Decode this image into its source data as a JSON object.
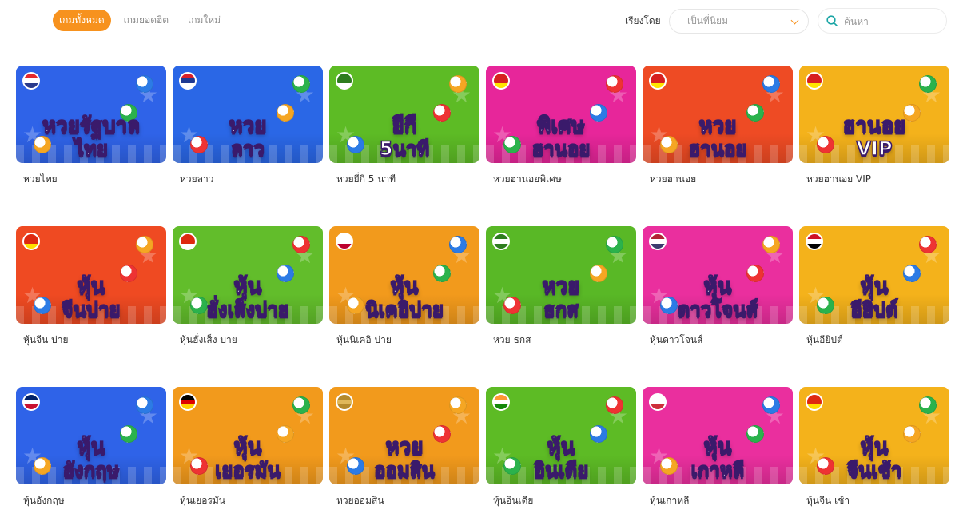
{
  "tabs": [
    {
      "label": "เกมทั้งหมด",
      "active": true
    },
    {
      "label": "เกมยอดฮิต",
      "active": false
    },
    {
      "label": "เกมใหม่",
      "active": false
    }
  ],
  "sort": {
    "label": "เรียงโดย",
    "selected": "เป็นที่นิยม"
  },
  "search": {
    "placeholder": "ค้นหา"
  },
  "games": [
    {
      "label": "หวยไทย",
      "art": [
        "หวยรัฐบาล",
        "ไทย"
      ],
      "bg": "#2f63e8",
      "flag": "thailand-flag-icon",
      "flagColors": [
        "#e4282d",
        "#ffffff",
        "#2a3a8c"
      ]
    },
    {
      "label": "หวยลาว",
      "art": [
        "หวย",
        "ลาว"
      ],
      "bg": "#2a67e6",
      "flag": "laos-flag-icon",
      "flagColors": [
        "#d9202a",
        "#1f3a93",
        "#ffffff"
      ]
    },
    {
      "label": "หวยยี่กี 5 นาที",
      "art": [
        "ยีกี",
        "5นาที"
      ],
      "bg": "#5dbb25",
      "flag": "yk-badge-icon",
      "flagColors": [
        "#2e7d1e",
        "#2e7d1e",
        "#ffffff"
      ]
    },
    {
      "label": "หวยฮานอยพิเศษ",
      "art": [
        "พิเศษ",
        "ฮานอย"
      ],
      "bg": "#e7269a",
      "flag": "vietnam-flag-icon",
      "flagColors": [
        "#d7201f",
        "#d7201f",
        "#ffe500"
      ]
    },
    {
      "label": "หวยฮานอย",
      "art": [
        "หวย",
        "ฮานอย"
      ],
      "bg": "#ee4b24",
      "flag": "vietnam-flag-icon",
      "flagColors": [
        "#d7201f",
        "#d7201f",
        "#ffe500"
      ]
    },
    {
      "label": "หวยฮานอย VIP",
      "art": [
        "ฮานอย",
        "VIP"
      ],
      "bg": "#f4b21b",
      "flag": "vietnam-flag-icon",
      "flagColors": [
        "#d7201f",
        "#d7201f",
        "#ffe500"
      ]
    },
    {
      "label": "หุ้นจีน บ่าย",
      "art": [
        "หุ้น",
        "จีนบ่าย"
      ],
      "bg": "#ef4a22",
      "flag": "china-flag-icon",
      "flagColors": [
        "#de2910",
        "#de2910",
        "#ffde00"
      ]
    },
    {
      "label": "หุ้นฮั่งเส็ง บ่าย",
      "art": [
        "หุ้น",
        "ฮั่งเส็งบ่าย"
      ],
      "bg": "#62bd2b",
      "flag": "hongkong-flag-icon",
      "flagColors": [
        "#de2910",
        "#de2910",
        "#ffffff"
      ]
    },
    {
      "label": "หุ้นนิเคอิ บ่าย",
      "art": [
        "หุ้น",
        "นิเคอิบ่าย"
      ],
      "bg": "#f29a1c",
      "flag": "japan-flag-icon",
      "flagColors": [
        "#ffffff",
        "#ffffff",
        "#bc002d"
      ]
    },
    {
      "label": "หวย ธกส",
      "art": [
        "หวย",
        "ธกส"
      ],
      "bg": "#59b826",
      "flag": "baac-badge-icon",
      "flagColors": [
        "#2e7d1e",
        "#ffffff",
        "#2e7d1e"
      ]
    },
    {
      "label": "หุ้นดาวโจนส์",
      "art": [
        "หุ้น",
        "ดาวโจนส์"
      ],
      "bg": "#ea2f9e",
      "flag": "usa-flag-icon",
      "flagColors": [
        "#b22234",
        "#ffffff",
        "#3c3b6e"
      ]
    },
    {
      "label": "หุ้นอียิปต์",
      "art": [
        "หุ้น",
        "อียิปต์"
      ],
      "bg": "#f4b21b",
      "flag": "egypt-flag-icon",
      "flagColors": [
        "#ce1126",
        "#ffffff",
        "#000000"
      ]
    },
    {
      "label": "หุ้นอังกฤษ",
      "art": [
        "หุ้น",
        "อังกฤษ"
      ],
      "bg": "#2f63e8",
      "flag": "uk-flag-icon",
      "flagColors": [
        "#012169",
        "#ffffff",
        "#c8102e"
      ]
    },
    {
      "label": "หุ้นเยอรมัน",
      "art": [
        "หุ้น",
        "เยอรมัน"
      ],
      "bg": "#f29a1c",
      "flag": "germany-flag-icon",
      "flagColors": [
        "#000000",
        "#dd0000",
        "#ffce00"
      ]
    },
    {
      "label": "หวยออมสิน",
      "art": [
        "หวย",
        "ออมสิน"
      ],
      "bg": "#f29a1c",
      "flag": "gsb-badge-icon",
      "flagColors": [
        "#b58a2c",
        "#e0b85a",
        "#b58a2c"
      ]
    },
    {
      "label": "หุ้นอินเดีย",
      "art": [
        "หุ้น",
        "อินเดีย"
      ],
      "bg": "#5dbb25",
      "flag": "india-flag-icon",
      "flagColors": [
        "#ff9933",
        "#ffffff",
        "#138808"
      ]
    },
    {
      "label": "หุ้นเกาหลี",
      "art": [
        "หุ้น",
        "เกาหลี"
      ],
      "bg": "#ea2f9e",
      "flag": "korea-flag-icon",
      "flagColors": [
        "#ffffff",
        "#ffffff",
        "#cd2e3a"
      ]
    },
    {
      "label": "หุ้นจีน เช้า",
      "art": [
        "หุ้น",
        "จีนเช้า"
      ],
      "bg": "#f4b21b",
      "flag": "china-flag-icon",
      "flagColors": [
        "#de2910",
        "#de2910",
        "#ffde00"
      ]
    }
  ]
}
